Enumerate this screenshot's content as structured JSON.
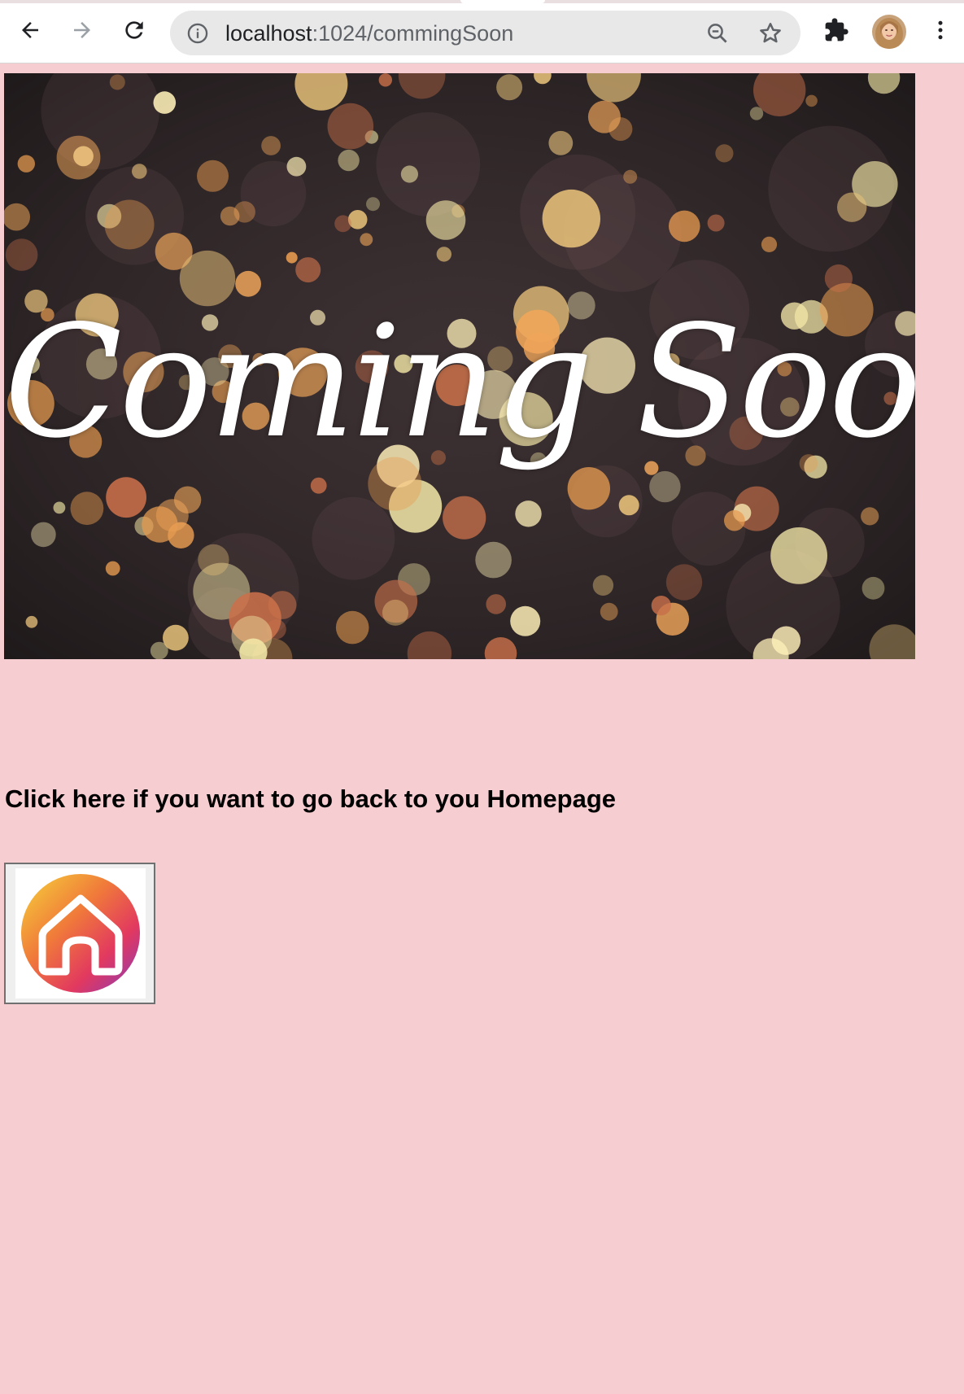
{
  "browser": {
    "url_host": "localhost",
    "url_path": ":1024/commingSoon",
    "back_icon": "arrow-left-icon",
    "forward_icon": "arrow-right-icon",
    "reload_icon": "reload-icon",
    "info_icon": "info-icon",
    "zoom_icon": "zoom-out-icon",
    "bookmark_icon": "star-icon",
    "extensions_icon": "puzzle-icon",
    "menu_icon": "kebab-menu-icon"
  },
  "hero": {
    "title": "Coming Soon"
  },
  "page": {
    "back_text": "Click here if you want to go back to you Homepage",
    "home_button_icon": "home-icon",
    "background_color": "#f6cdd0"
  }
}
